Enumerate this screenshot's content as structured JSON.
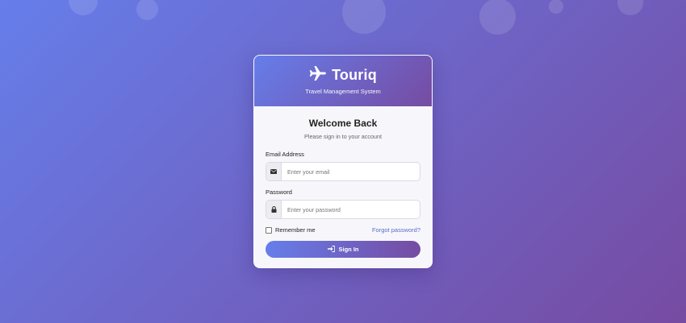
{
  "brand": {
    "name": "Touriq",
    "tagline": "Travel Management System",
    "icon": "plane-icon"
  },
  "login": {
    "heading": "Welcome Back",
    "subtitle": "Please sign in to your account",
    "email_label": "Email Address",
    "email_placeholder": "Enter your email",
    "email_icon": "envelope-icon",
    "password_label": "Password",
    "password_placeholder": "Enter your password",
    "password_icon": "lock-icon",
    "remember_label": "Remember me",
    "remember_checked": false,
    "forgot_label": "Forgot password?",
    "signin_label": "Sign In",
    "signin_icon": "sign-in-icon"
  },
  "colors": {
    "gradient_start": "#667eea",
    "gradient_end": "#764ba2",
    "link": "#5b6bc9"
  }
}
